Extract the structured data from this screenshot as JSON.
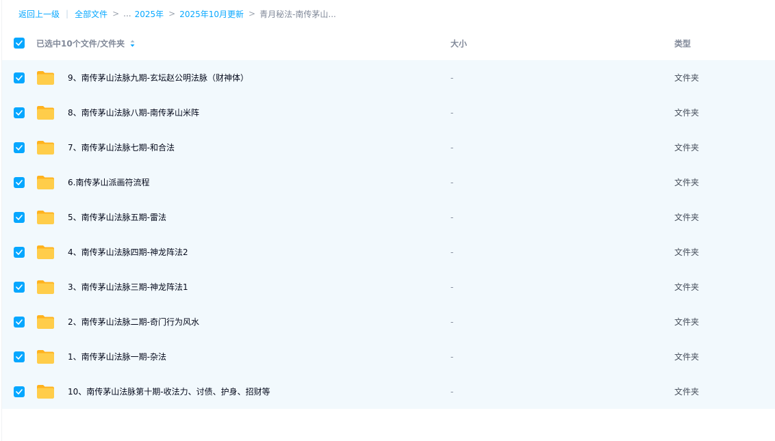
{
  "breadcrumb": {
    "back": "返回上一级",
    "all_files": "全部文件",
    "sep": ">",
    "ellipsis": "...",
    "level1": "2025年",
    "level2": "2025年10月更新",
    "current": "青月秘法-南传茅山..."
  },
  "header": {
    "selection_label": "已选中10个文件/文件夹",
    "size_label": "大小",
    "type_label": "类型"
  },
  "files": [
    {
      "name": "9、南传茅山法脉九期-玄坛赵公明法脉（财神体）",
      "size": "-",
      "type": "文件夹"
    },
    {
      "name": "8、南传茅山法脉八期-南传茅山米阵",
      "size": "-",
      "type": "文件夹"
    },
    {
      "name": "7、南传茅山法脉七期-和合法",
      "size": "-",
      "type": "文件夹"
    },
    {
      "name": "6.南传茅山派画符流程",
      "size": "-",
      "type": "文件夹"
    },
    {
      "name": "5、南传茅山法脉五期-雷法",
      "size": "-",
      "type": "文件夹"
    },
    {
      "name": "4、南传茅山法脉四期-神龙阵法2",
      "size": "-",
      "type": "文件夹"
    },
    {
      "name": "3、南传茅山法脉三期-神龙阵法1",
      "size": "-",
      "type": "文件夹"
    },
    {
      "name": "2、南传茅山法脉二期-奇门行为风水",
      "size": "-",
      "type": "文件夹"
    },
    {
      "name": "1、南传茅山法脉一期-杂法",
      "size": "-",
      "type": "文件夹"
    },
    {
      "name": "10、南传茅山法脉第十期-收法力、讨债、护身、招财等",
      "size": "-",
      "type": "文件夹"
    }
  ],
  "icons": {
    "checkbox": "checkbox-checked-icon",
    "folder": "folder-icon",
    "sort": "sort-icon"
  },
  "colors": {
    "accent": "#06a7ff",
    "row_selected_bg": "#f2f9fd",
    "folder": "#ffc53d"
  }
}
